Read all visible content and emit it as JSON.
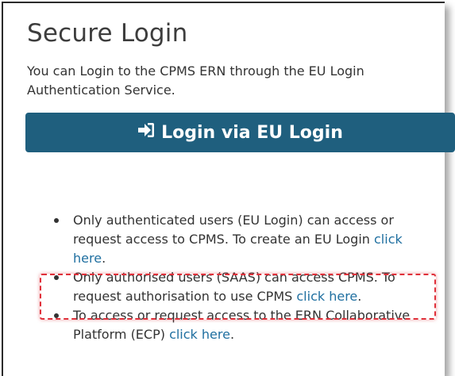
{
  "title": "Secure Login",
  "intro": "You can Login to the CPMS ERN through the EU Login Authentication Service.",
  "login_button": {
    "label": "Login via EU Login",
    "icon": "sign-in-icon"
  },
  "items": [
    {
      "text": "Only authenticated users (EU Login) can access or request access to CPMS. To create an EU Login ",
      "link": "click here",
      "after": "."
    },
    {
      "text": "Only authorised users (SAAS) can access CPMS. To request authorisation to use CPMS ",
      "link": "click here",
      "after": "."
    },
    {
      "text": "To access or request access to the ERN Collaborative Platform (ECP) ",
      "link": "click here",
      "after": "."
    }
  ],
  "colors": {
    "button": "#1f5f7e",
    "link": "#1f6fa0",
    "highlight": "#e0303a"
  }
}
